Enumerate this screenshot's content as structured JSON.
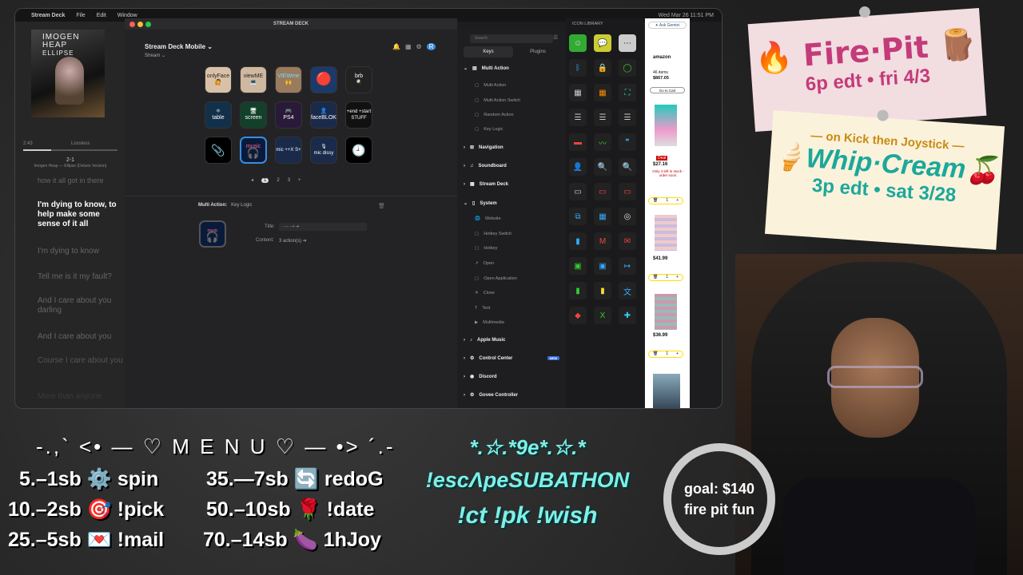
{
  "menubar": {
    "app": "Stream Deck",
    "items": [
      "File",
      "Edit",
      "Window"
    ],
    "clock": "Wed Mar 26  11:51 PM"
  },
  "music": {
    "artist": "IMOGEN HEAP",
    "album": "ELLIPSE",
    "time": "2:43",
    "quality": "Lossless",
    "track": "2-1",
    "track_sub": "Imogen Heap — Ellipse (Deluxe Version)",
    "lyrics": [
      "how it all got in there",
      "I'm dying to know, to help make some sense of it all",
      "I'm dying to know",
      "Tell me is it my fault?",
      "And I care about you darling",
      "And I care about you",
      "Course I care about you",
      "More than anyone"
    ]
  },
  "streamdeck": {
    "window_title": "STREAM DECK",
    "device": "Stream Deck Mobile",
    "profile": "Stream",
    "keys": [
      [
        "onlyFace",
        "viewME",
        "VIEWme",
        "",
        "brb"
      ],
      [
        "table",
        "screen",
        "PS4",
        "faceBLOK",
        "+end +start STUFF"
      ],
      [
        "",
        "music",
        "mic ++X S+",
        "mic dissy",
        ""
      ]
    ],
    "pages": [
      "1",
      "2",
      "3"
    ],
    "action_label": "Multi Action:",
    "action_value": "Key Logic",
    "title_label": "Title:",
    "title_value": "- --- --+ ➔",
    "content_label": "Content:",
    "content_value": "3 action(s)"
  },
  "actions": {
    "search_placeholder": "Search",
    "tabs": [
      "Keys",
      "Plugins"
    ],
    "multi_action": {
      "label": "Multi Action",
      "items": [
        "Multi Action",
        "Multi Action Switch",
        "Random Action",
        "Key Logic"
      ]
    },
    "categories_top": [
      "Navigation",
      "Soundboard",
      "Stream Deck"
    ],
    "system": {
      "label": "System",
      "items": [
        "Website",
        "Hotkey Switch",
        "Hotkey",
        "Open",
        "Open Application",
        "Close",
        "Text",
        "Multimedia"
      ]
    },
    "categories_bottom": [
      "Apple Music",
      "Control Center",
      "Discord",
      "Govee Controller"
    ],
    "new_badge": "NEW"
  },
  "icon_library": {
    "title": "ICON LIBRARY"
  },
  "amazon": {
    "brand": "amazon",
    "count": "46 items",
    "total": "$867.05",
    "cart_btn": "Go to Cart",
    "deal": "Deal",
    "p1": "$27.16",
    "p1_note": "Only 4 left in stock - order soon.",
    "qty": "1",
    "p2": "$41.99",
    "p3": "$36.99",
    "ask": "Ask Gemini"
  },
  "menu": {
    "title": "-.,` <• — ♡ M E N U ♡ — •> ´.-",
    "left": [
      "5.–1sb ⚙️ spin",
      "10.–2sb 🎯 !pick",
      "25.–5sb 💌 !mail"
    ],
    "right": [
      "35.—7sb 🔄 redoG",
      "50.–10sb 🌹 !date",
      "70.–14sb 🍆 1hJoy"
    ]
  },
  "subathon": {
    "deco": "*.☆.*9e*.☆.*",
    "name": "!escΛpeSUBATHON",
    "cmds": "!ct !pk !wish"
  },
  "goal": {
    "line1": "goal: $140",
    "line2": "fire pit fun"
  },
  "note1": {
    "title": "Fire·Pit",
    "time": "6p edt • fri 4/3"
  },
  "note2": {
    "top": "— on Kick then Joystick —",
    "title": "Whip·Cream",
    "time": "3p edt • sat 3/28"
  },
  "colors": {
    "accent": "#3a8de0",
    "note_pink": "#c43b7a",
    "teal": "#7df0e8"
  }
}
